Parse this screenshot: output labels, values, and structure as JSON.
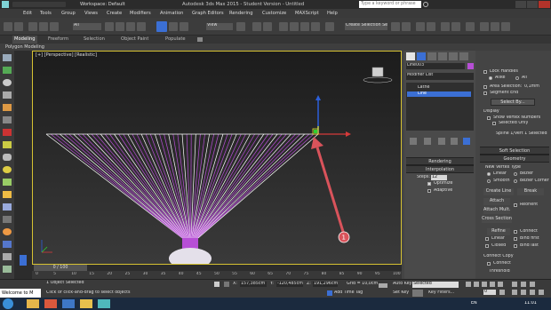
{
  "window": {
    "title": "Autodesk 3ds Max 2015 - Student Version - Untitled",
    "workspace_label": "Workspace: Default",
    "search_placeholder": "Type a keyword or phrase"
  },
  "menu": [
    "Edit",
    "Tools",
    "Group",
    "Views",
    "Create",
    "Modifiers",
    "Animation",
    "Graph Editors",
    "Rendering",
    "Customize",
    "MAXScript",
    "Help"
  ],
  "toolbar": {
    "selection_filter": "All",
    "view_dropdown": "View",
    "named_selection": "Create Selection Se"
  },
  "ribbon": {
    "tabs": [
      "Modeling",
      "Freeform",
      "Selection",
      "Object Paint",
      "Populate"
    ],
    "subtab": "Polygon Modeling"
  },
  "viewport": {
    "label": "[+] [Perspective] [Realistic]",
    "annotation_number": "1"
  },
  "timeline": {
    "frame": "0 / 100",
    "ticks": [
      "0",
      "5",
      "10",
      "15",
      "20",
      "25",
      "30",
      "35",
      "40",
      "45",
      "50",
      "55",
      "60",
      "65",
      "70",
      "75",
      "80",
      "85",
      "90",
      "95",
      "100"
    ]
  },
  "command_panel": {
    "object_name": "Line003",
    "modifier_list": "Modifier List",
    "stack": [
      "Lathe",
      "Line"
    ],
    "rendering_label": "Rendering",
    "interpolation_label": "Interpolation",
    "steps_label": "Steps:",
    "steps_value": "12",
    "optimize_label": "Optimize",
    "adaptive_label": "Adaptive"
  },
  "right_panel": {
    "lock_handles": "Lock Handles",
    "alike": "Alike",
    "all": "All",
    "area_selection": "Area Selection:",
    "area_value": "0,1mm",
    "segment_end": "Segment End",
    "select_by": "Select By...",
    "display_label": "Display",
    "show_vertex_numbers": "Show Vertex Numbers",
    "selected_only": "Selected Only",
    "spline_status": "Spline 1/Vert 1 Selected",
    "soft_selection": "Soft Selection",
    "geometry": "Geometry",
    "new_vertex_type": "New Vertex Type",
    "linear": "Linear",
    "bezier": "Bezier",
    "smooth": "Smooth",
    "bezier_corner": "Bezier Corner",
    "create_line": "Create Line",
    "break": "Break",
    "attach": "Attach",
    "reorient": "Reorient",
    "attach_mult": "Attach Mult.",
    "cross_section": "Cross Section",
    "refine": "Refine",
    "connect": "Connect",
    "linear2": "Linear",
    "bind_first": "Bind first",
    "closed": "Closed",
    "bind_last": "Bind last",
    "connect_copy": "Connect Copy",
    "connect2": "Connect",
    "threshold": "Threshold"
  },
  "status": {
    "maxscript": "Welcome to M",
    "selected": "1 Object Selected",
    "hint": "Click or click-and-drag to select objects",
    "x_label": "X:",
    "x_value": "157,385cm",
    "y_label": "Y:",
    "y_value": "-120,485cm",
    "z_label": "Z:",
    "z_value": "191,296cm",
    "grid": "Grid = 10,0cm",
    "add_time_tag": "Add Time Tag",
    "auto_key": "Auto Key",
    "selected_dropdown": "Selected",
    "set_key": "Set Key",
    "key_filters": "Key Filters...",
    "frame_value": "0"
  },
  "taskbar": {
    "time": "11:01",
    "language": "EN"
  },
  "colors": {
    "viewport_border": "#d6c232",
    "lathe_purple": "#b74fd6",
    "arrow_red": "#d9535b",
    "stack_selected": "#3b6fd4"
  }
}
